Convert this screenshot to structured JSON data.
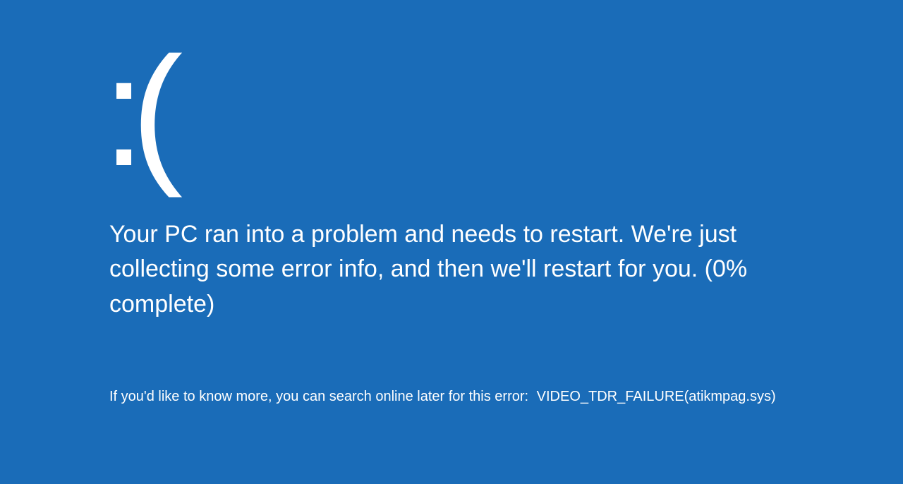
{
  "bsod": {
    "emoticon": ":(",
    "message": "Your PC ran into a problem and needs to restart. We're just collecting some error info, and then we'll restart for you. (0% complete)",
    "footer_prefix": "If you'd like to know more, you can search online later for this error:",
    "error_code": "VIDEO_TDR_FAILURE(atikmpag.sys)"
  }
}
